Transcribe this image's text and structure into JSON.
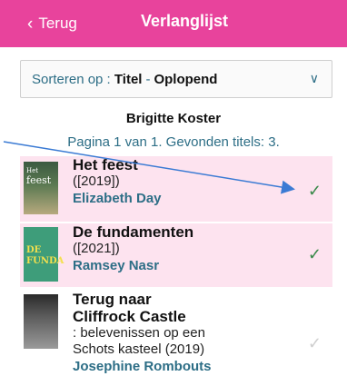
{
  "header": {
    "back_label": "Terug",
    "title": "Verlanglijst",
    "color": "#e8439c"
  },
  "sort": {
    "label": "Sorteren op :",
    "field": "Titel",
    "separator": "-",
    "order": "Oplopend"
  },
  "list": {
    "owner": "Brigitte Koster",
    "page_info": "Pagina 1 van 1. Gevonden titels: 3.",
    "items": [
      {
        "title": "Het feest",
        "year": "([2019])",
        "author": "Elizabeth Day",
        "cover_text": [
          "Het",
          "feest"
        ],
        "checked": true
      },
      {
        "title": "De fundamenten",
        "year": "([2021])",
        "author": "Ramsey Nasr",
        "cover_text": [
          "DE",
          "FUNDA"
        ],
        "checked": true
      },
      {
        "title_line1": "Terug naar",
        "title_line2": "Cliffrock Castle",
        "subtitle_line1": ": belevenissen op een",
        "subtitle_line2": "Schots kasteel (2019)",
        "author": "Josephine Rombouts",
        "checked": false
      }
    ]
  },
  "colors": {
    "accent_text": "#2d6e86",
    "selected_row": "#fde3ef",
    "check_active": "#3a8a4a"
  }
}
